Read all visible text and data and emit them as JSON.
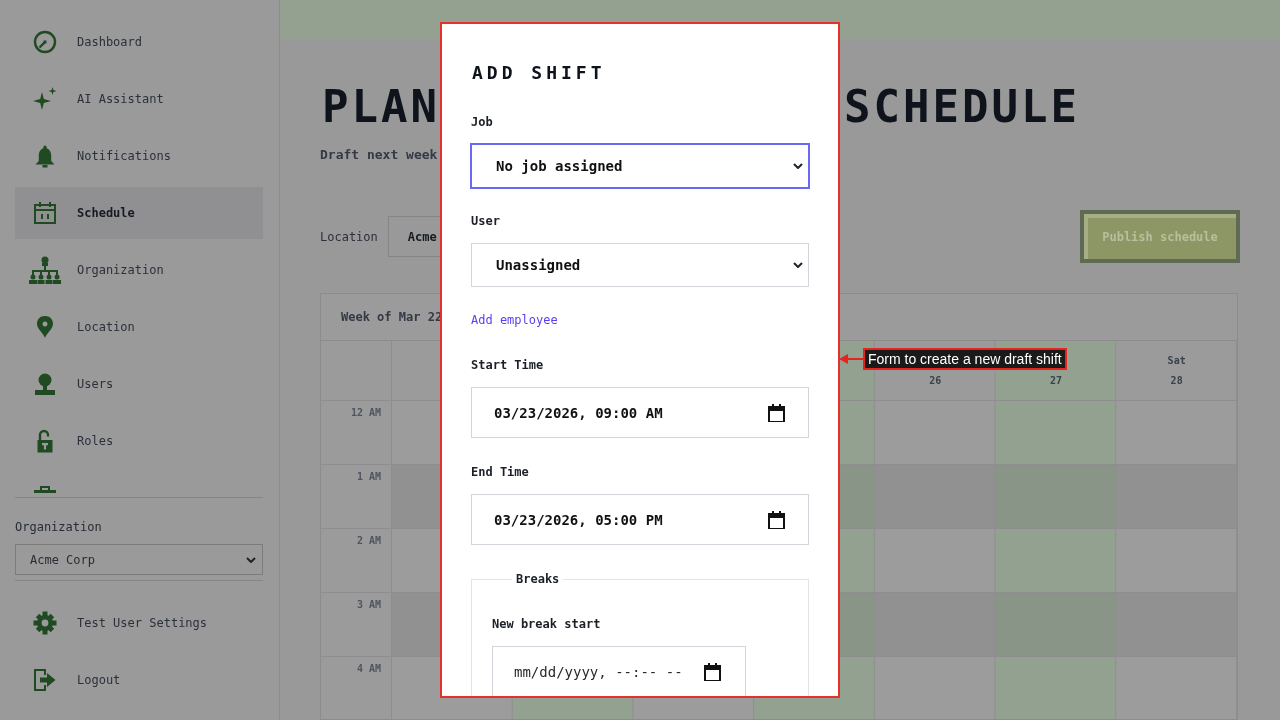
{
  "sidebar": {
    "nav_items": [
      {
        "label": "Dashboard",
        "selected": false
      },
      {
        "label": "AI Assistant",
        "selected": false
      },
      {
        "label": "Notifications",
        "selected": false
      },
      {
        "label": "Schedule",
        "selected": true
      },
      {
        "label": "Organization",
        "selected": false
      },
      {
        "label": "Location",
        "selected": false
      },
      {
        "label": "Users",
        "selected": false
      },
      {
        "label": "Roles",
        "selected": false
      }
    ],
    "organization": {
      "label": "Organization",
      "value": "Acme Corp"
    },
    "footer_items": [
      {
        "label": "Test User Settings"
      },
      {
        "label": "Logout"
      }
    ]
  },
  "page": {
    "title_left": "PLAN",
    "title_right": "SCHEDULE",
    "subtitle": "Draft next week",
    "location": {
      "label": "Location",
      "value": "Acme"
    },
    "publish_button": {
      "label": "Publish schedule"
    }
  },
  "calendar": {
    "week_label": "Week of Mar 22",
    "days": [
      {
        "date": "26"
      },
      {
        "date": "27"
      },
      {
        "name": "Sat",
        "date": "28"
      }
    ],
    "hours": [
      "12 AM",
      "1 AM",
      "2 AM",
      "3 AM",
      "4 AM"
    ]
  },
  "dialog": {
    "title": "ADD SHIFT",
    "fields": [
      {
        "kind": "select",
        "label": "Job",
        "value": "No job assigned",
        "focused": true
      },
      {
        "kind": "select",
        "label": "User",
        "value": "Unassigned",
        "focused": false
      },
      {
        "kind": "link",
        "label": "Add employee"
      },
      {
        "kind": "datetime",
        "label": "Start Time",
        "value": "03/23/2026, 09:00 AM"
      },
      {
        "kind": "datetime",
        "label": "End Time",
        "value": "03/23/2026, 05:00 PM"
      },
      {
        "kind": "fieldset",
        "legend": "Breaks",
        "fields": [
          {
            "kind": "datetime",
            "label": "New break start",
            "placeholder": "mm/dd/yyyy, --:-- --"
          }
        ]
      }
    ]
  },
  "annotation": {
    "text": "Form to create a new draft shift"
  }
}
